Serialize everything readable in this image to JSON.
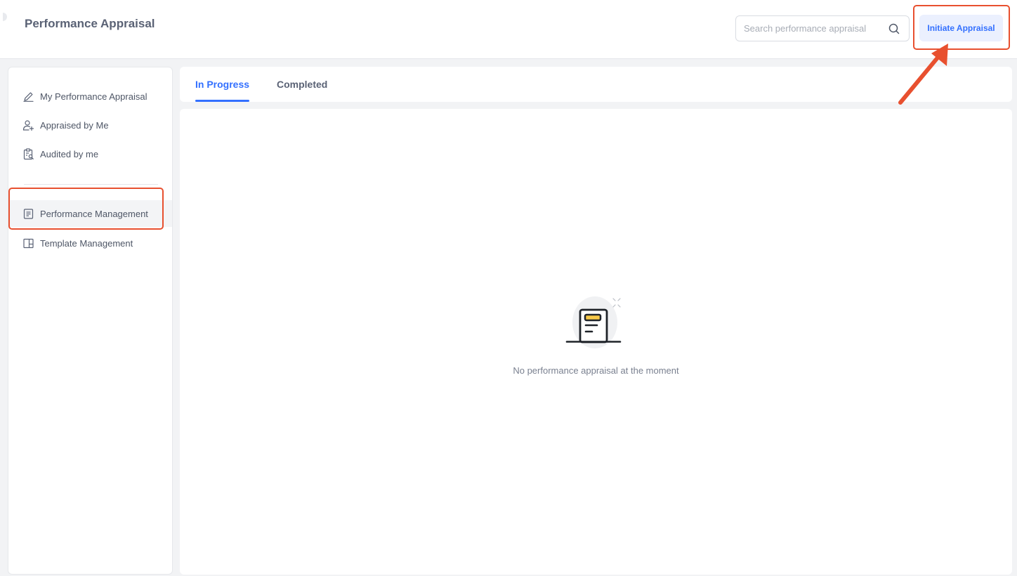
{
  "header": {
    "title": "Performance Appraisal",
    "search_placeholder": "Search performance appraisal",
    "search_icon": "search-icon",
    "initiate_label": "Initiate Appraisal"
  },
  "sidebar": {
    "items": [
      {
        "label": "My Performance Appraisal",
        "icon": "pencil-icon"
      },
      {
        "label": "Appraised by Me",
        "icon": "user-add-icon"
      },
      {
        "label": "Audited by me",
        "icon": "clipboard-search-icon"
      },
      {
        "label": "Performance Management",
        "icon": "document-list-icon",
        "active": true
      },
      {
        "label": "Template Management",
        "icon": "layout-panel-icon"
      }
    ]
  },
  "tabs": [
    {
      "label": "In Progress",
      "active": true
    },
    {
      "label": "Completed",
      "active": false
    }
  ],
  "main": {
    "empty_message": "No performance appraisal at the moment",
    "empty_icon": "empty-document-icon"
  },
  "colors": {
    "accent": "#3370ff",
    "annotation": "#e8502f",
    "button_bg": "#ebf0fe"
  }
}
